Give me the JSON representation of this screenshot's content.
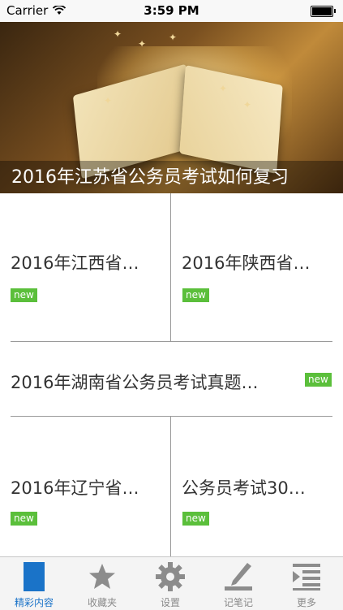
{
  "status_bar": {
    "carrier": "Carrier",
    "time": "3:59 PM"
  },
  "hero": {
    "title": "2016年江苏省公务员考试如何复习"
  },
  "articles": [
    {
      "title": "2016年江西省…",
      "badge": "new"
    },
    {
      "title": "2016年陕西省…",
      "badge": "new"
    },
    {
      "title": "2016年湖南省公务员考试真题…",
      "badge": "new"
    },
    {
      "title": "2016年辽宁省…",
      "badge": "new"
    },
    {
      "title": "公务员考试30…",
      "badge": "new"
    }
  ],
  "tab_bar": {
    "active_color": "#1a73c8",
    "items": [
      {
        "label": "精彩内容",
        "icon": "article-icon",
        "active": true
      },
      {
        "label": "收藏夹",
        "icon": "star-icon",
        "active": false
      },
      {
        "label": "设置",
        "icon": "gear-icon",
        "active": false
      },
      {
        "label": "记笔记",
        "icon": "pen-icon",
        "active": false
      },
      {
        "label": "更多",
        "icon": "more-list-icon",
        "active": false
      }
    ]
  }
}
